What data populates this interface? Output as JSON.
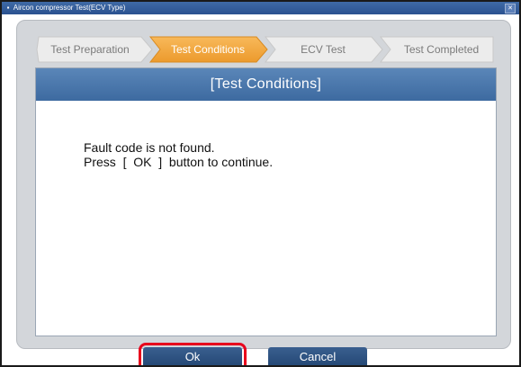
{
  "window": {
    "title": "Aircon compressor Test(ECV Type)",
    "icon": "app-icon",
    "close_icon": "close-icon"
  },
  "steps": [
    {
      "label": "Test Preparation",
      "state": "done"
    },
    {
      "label": "Test Conditions",
      "state": "active"
    },
    {
      "label": "ECV Test",
      "state": "pending"
    },
    {
      "label": "Test Completed",
      "state": "pending"
    }
  ],
  "panel": {
    "header": "[Test Conditions]",
    "message_line1": "Fault code is not found.",
    "message_line2": "Press  [  OK  ]  button to continue."
  },
  "buttons": {
    "ok_label": "Ok",
    "cancel_label": "Cancel"
  },
  "colors": {
    "active_step": "#f0a33a",
    "inactive_step": "#ececec",
    "header_blue": "#4a77ab",
    "highlight_red": "#e8001c"
  }
}
